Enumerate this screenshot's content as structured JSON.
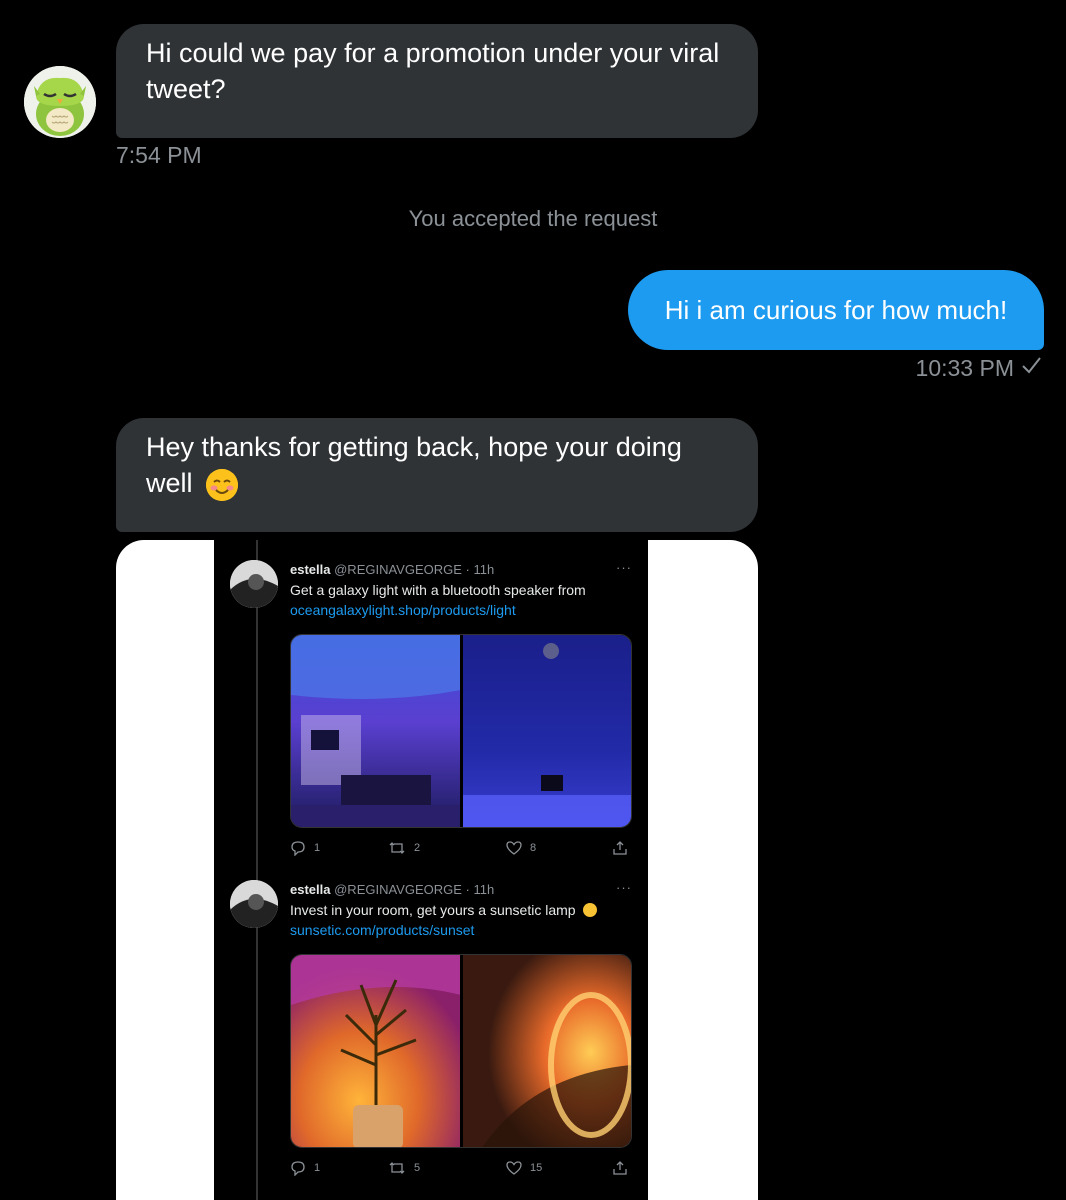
{
  "messages": [
    {
      "text": "Hi could we pay for a promotion under your viral tweet?",
      "time": "7:54 PM"
    },
    {
      "text": "You accepted the request"
    },
    {
      "text": "Hi i am curious for how much!",
      "time": "10:33 PM"
    },
    {
      "text": "Hey thanks for getting back, hope your doing well"
    }
  ],
  "screenshot": {
    "tweets": [
      {
        "name": "estella",
        "handle": "@REGINAVGEORGE · 11h",
        "text": "Get a galaxy light with a bluetooth speaker from",
        "link": "oceangalaxylight.shop/products/light",
        "replies": "1",
        "retweets": "2",
        "likes": "8"
      },
      {
        "name": "estella",
        "handle": "@REGINAVGEORGE · 11h",
        "text": "Invest in your room, get yours a sunsetic lamp",
        "link": "sunsetic.com/products/sunset",
        "replies": "1",
        "retweets": "5",
        "likes": "15"
      }
    ]
  },
  "colors": {
    "outgoing": "#1d9bf0",
    "incoming": "#2f3336",
    "link": "#1d9bf0"
  },
  "icons": [
    "owl-avatar-icon",
    "check-icon",
    "smiling-face-emoji-icon",
    "reply-icon",
    "retweet-icon",
    "like-icon",
    "share-icon",
    "more-icon"
  ]
}
